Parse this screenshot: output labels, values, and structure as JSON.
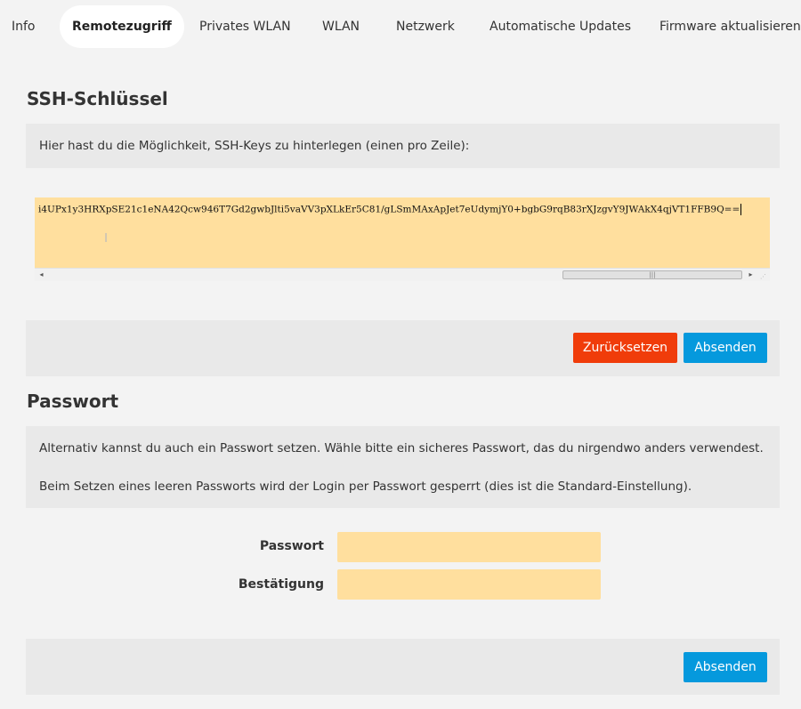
{
  "tabs": [
    {
      "label": "Info",
      "active": false
    },
    {
      "label": "Remotezugriff",
      "active": true
    },
    {
      "label": "Privates WLAN",
      "active": false
    },
    {
      "label": "WLAN",
      "active": false
    },
    {
      "label": "Netzwerk",
      "active": false
    },
    {
      "label": "Automatische Updates",
      "active": false
    },
    {
      "label": "Firmware aktualisieren",
      "active": false
    }
  ],
  "ssh": {
    "title": "SSH-Schlüssel",
    "info": "Hier hast du die Möglichkeit, SSH-Keys zu hinterlegen (einen pro Zeile):",
    "key_value": "i4UPx1y3HRXpSE21c1eNA42Qcw946T7Gd2gwbJlti5vaVV3pXLkEr5C81/gLSmMAxApJet7eUdymjY0+bgbG9rqB83rXJzgvY9JWAkX4qjVT1FFB9Q==",
    "reset_label": "Zurücksetzen",
    "submit_label": "Absenden"
  },
  "password": {
    "title": "Passwort",
    "info_line1": "Alternativ kannst du auch ein Passwort setzen. Wähle bitte ein sicheres Passwort, das du nirgendwo anders verwendest.",
    "info_line2": "Beim Setzen eines leeren Passworts wird der Login per Passwort gesperrt (dies ist die Standard-Einstellung).",
    "password_label": "Passwort",
    "password_value": "",
    "confirm_label": "Bestätigung",
    "confirm_value": "",
    "submit_label": "Absenden"
  },
  "colors": {
    "input_bg": "#ffdf9e",
    "reset_button": "#f03c0a",
    "submit_button": "#0599dd",
    "panel_bg": "#e9e9e9"
  },
  "icons": {
    "scroll_left": "scroll-left-arrow-icon",
    "scroll_right": "scroll-right-arrow-icon",
    "thumb_grip": "scroll-thumb-grip-icon",
    "resize": "resize-grip-icon",
    "cursor": "text-cursor-icon"
  }
}
